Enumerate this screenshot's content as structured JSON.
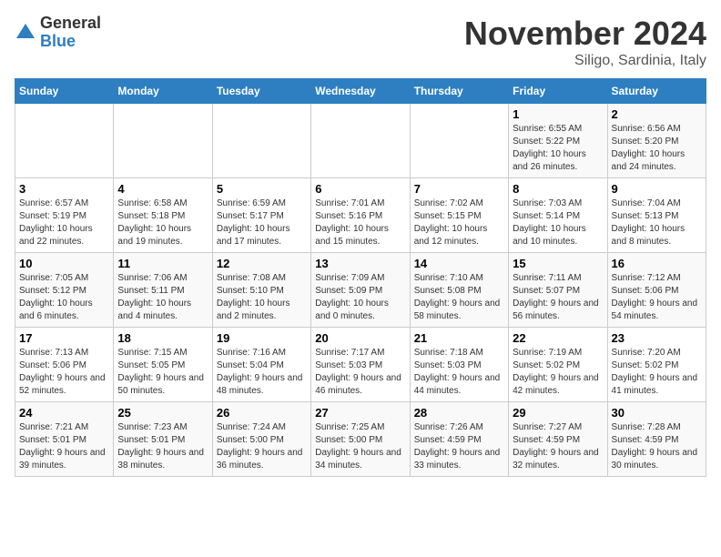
{
  "header": {
    "logo_general": "General",
    "logo_blue": "Blue",
    "month_title": "November 2024",
    "location": "Siligo, Sardinia, Italy"
  },
  "weekdays": [
    "Sunday",
    "Monday",
    "Tuesday",
    "Wednesday",
    "Thursday",
    "Friday",
    "Saturday"
  ],
  "weeks": [
    [
      {
        "day": "",
        "detail": ""
      },
      {
        "day": "",
        "detail": ""
      },
      {
        "day": "",
        "detail": ""
      },
      {
        "day": "",
        "detail": ""
      },
      {
        "day": "",
        "detail": ""
      },
      {
        "day": "1",
        "detail": "Sunrise: 6:55 AM\nSunset: 5:22 PM\nDaylight: 10 hours and 26 minutes."
      },
      {
        "day": "2",
        "detail": "Sunrise: 6:56 AM\nSunset: 5:20 PM\nDaylight: 10 hours and 24 minutes."
      }
    ],
    [
      {
        "day": "3",
        "detail": "Sunrise: 6:57 AM\nSunset: 5:19 PM\nDaylight: 10 hours and 22 minutes."
      },
      {
        "day": "4",
        "detail": "Sunrise: 6:58 AM\nSunset: 5:18 PM\nDaylight: 10 hours and 19 minutes."
      },
      {
        "day": "5",
        "detail": "Sunrise: 6:59 AM\nSunset: 5:17 PM\nDaylight: 10 hours and 17 minutes."
      },
      {
        "day": "6",
        "detail": "Sunrise: 7:01 AM\nSunset: 5:16 PM\nDaylight: 10 hours and 15 minutes."
      },
      {
        "day": "7",
        "detail": "Sunrise: 7:02 AM\nSunset: 5:15 PM\nDaylight: 10 hours and 12 minutes."
      },
      {
        "day": "8",
        "detail": "Sunrise: 7:03 AM\nSunset: 5:14 PM\nDaylight: 10 hours and 10 minutes."
      },
      {
        "day": "9",
        "detail": "Sunrise: 7:04 AM\nSunset: 5:13 PM\nDaylight: 10 hours and 8 minutes."
      }
    ],
    [
      {
        "day": "10",
        "detail": "Sunrise: 7:05 AM\nSunset: 5:12 PM\nDaylight: 10 hours and 6 minutes."
      },
      {
        "day": "11",
        "detail": "Sunrise: 7:06 AM\nSunset: 5:11 PM\nDaylight: 10 hours and 4 minutes."
      },
      {
        "day": "12",
        "detail": "Sunrise: 7:08 AM\nSunset: 5:10 PM\nDaylight: 10 hours and 2 minutes."
      },
      {
        "day": "13",
        "detail": "Sunrise: 7:09 AM\nSunset: 5:09 PM\nDaylight: 10 hours and 0 minutes."
      },
      {
        "day": "14",
        "detail": "Sunrise: 7:10 AM\nSunset: 5:08 PM\nDaylight: 9 hours and 58 minutes."
      },
      {
        "day": "15",
        "detail": "Sunrise: 7:11 AM\nSunset: 5:07 PM\nDaylight: 9 hours and 56 minutes."
      },
      {
        "day": "16",
        "detail": "Sunrise: 7:12 AM\nSunset: 5:06 PM\nDaylight: 9 hours and 54 minutes."
      }
    ],
    [
      {
        "day": "17",
        "detail": "Sunrise: 7:13 AM\nSunset: 5:06 PM\nDaylight: 9 hours and 52 minutes."
      },
      {
        "day": "18",
        "detail": "Sunrise: 7:15 AM\nSunset: 5:05 PM\nDaylight: 9 hours and 50 minutes."
      },
      {
        "day": "19",
        "detail": "Sunrise: 7:16 AM\nSunset: 5:04 PM\nDaylight: 9 hours and 48 minutes."
      },
      {
        "day": "20",
        "detail": "Sunrise: 7:17 AM\nSunset: 5:03 PM\nDaylight: 9 hours and 46 minutes."
      },
      {
        "day": "21",
        "detail": "Sunrise: 7:18 AM\nSunset: 5:03 PM\nDaylight: 9 hours and 44 minutes."
      },
      {
        "day": "22",
        "detail": "Sunrise: 7:19 AM\nSunset: 5:02 PM\nDaylight: 9 hours and 42 minutes."
      },
      {
        "day": "23",
        "detail": "Sunrise: 7:20 AM\nSunset: 5:02 PM\nDaylight: 9 hours and 41 minutes."
      }
    ],
    [
      {
        "day": "24",
        "detail": "Sunrise: 7:21 AM\nSunset: 5:01 PM\nDaylight: 9 hours and 39 minutes."
      },
      {
        "day": "25",
        "detail": "Sunrise: 7:23 AM\nSunset: 5:01 PM\nDaylight: 9 hours and 38 minutes."
      },
      {
        "day": "26",
        "detail": "Sunrise: 7:24 AM\nSunset: 5:00 PM\nDaylight: 9 hours and 36 minutes."
      },
      {
        "day": "27",
        "detail": "Sunrise: 7:25 AM\nSunset: 5:00 PM\nDaylight: 9 hours and 34 minutes."
      },
      {
        "day": "28",
        "detail": "Sunrise: 7:26 AM\nSunset: 4:59 PM\nDaylight: 9 hours and 33 minutes."
      },
      {
        "day": "29",
        "detail": "Sunrise: 7:27 AM\nSunset: 4:59 PM\nDaylight: 9 hours and 32 minutes."
      },
      {
        "day": "30",
        "detail": "Sunrise: 7:28 AM\nSunset: 4:59 PM\nDaylight: 9 hours and 30 minutes."
      }
    ]
  ]
}
